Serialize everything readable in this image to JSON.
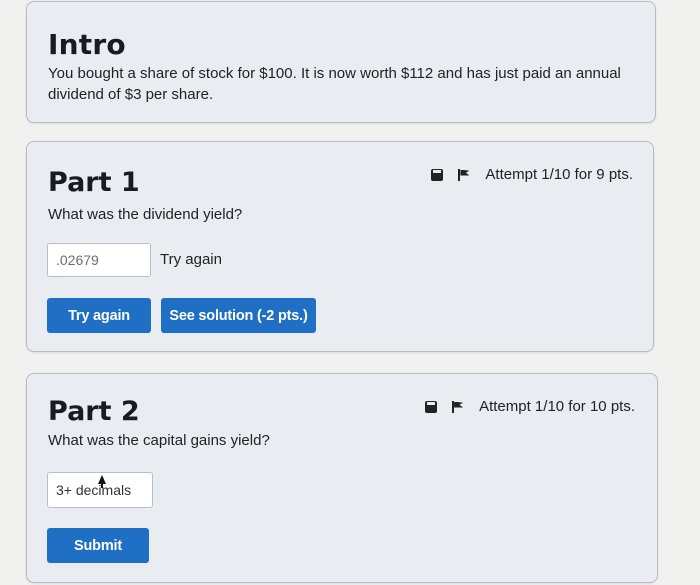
{
  "intro": {
    "title": "Intro",
    "text": "You bought a share of stock for $100. It is now worth $112 and has just paid an annual dividend of $3 per share."
  },
  "part1": {
    "title": "Part 1",
    "question": "What was the dividend yield?",
    "attempt": "Attempt 1/10 for 9 pts.",
    "answer_value": ".02679",
    "feedback": "Try again",
    "try_again_label": "Try again",
    "see_solution_label": "See solution (-2 pts.)"
  },
  "part2": {
    "title": "Part 2",
    "question": "What was the capital gains yield?",
    "attempt": "Attempt 1/10 for 10 pts.",
    "answer_placeholder": "3+ decimals",
    "submit_label": "Submit"
  },
  "icons": {
    "save": "save-icon",
    "flag": "flag-icon"
  },
  "colors": {
    "primary_button": "#1f6fc4",
    "card_background": "#e9ecf1"
  }
}
